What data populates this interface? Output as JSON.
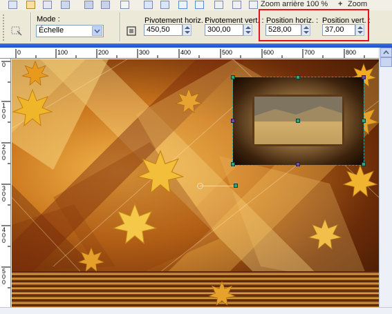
{
  "toolbar": {
    "zoom_label": "Zoom arrière 100 %",
    "zoom_label_2": "Zoom"
  },
  "options": {
    "mode_label": "Mode :",
    "mode_value": "Échelle",
    "pivot_h_label": "Pivotement horiz. :",
    "pivot_h_value": "450,50",
    "pivot_v_label": "Pivotement vert. :",
    "pivot_v_value": "300,00",
    "pos_h_label": "Position horiz. :",
    "pos_h_value": "528,00",
    "pos_v_label": "Position vert. :",
    "pos_v_value": "37,00"
  },
  "ruler_top": {
    "labels": [
      "0",
      "100",
      "200",
      "300",
      "400",
      "500",
      "600",
      "700",
      "800"
    ]
  },
  "ruler_left": {
    "labels": [
      "0",
      "1 0 0",
      "2 0 0",
      "3 0 0",
      "4 0 0",
      "5 0 0"
    ]
  },
  "colors": {
    "highlight": "#e5131b",
    "handle": "#2da57e",
    "titlebar": "#2a5fd8"
  }
}
